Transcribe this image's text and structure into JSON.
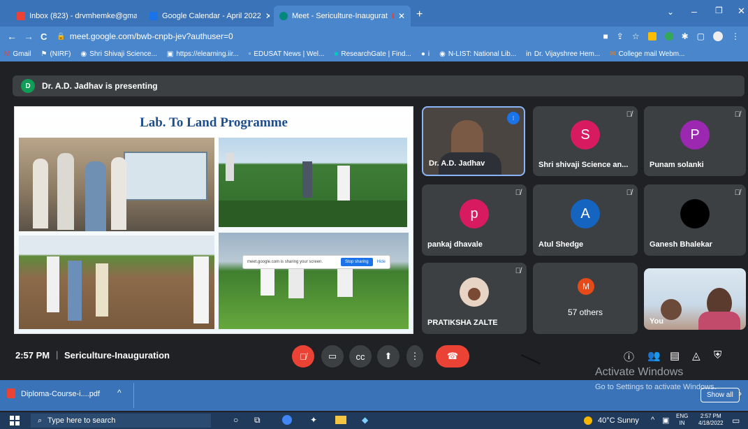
{
  "browser": {
    "tabs": [
      {
        "title": "Inbox (823) - drvmhemke@gmai",
        "icon": "gmail-icon",
        "color": "#ea4335"
      },
      {
        "title": "Google Calendar - April 2022",
        "icon": "calendar-icon",
        "color": "#1a73e8"
      },
      {
        "title": "Meet - Sericulture-Inaugurat",
        "icon": "meet-icon",
        "color": "#00897b"
      }
    ],
    "new_tab": "+",
    "url": "meet.google.com/bwb-cnpb-jev?authuser=0",
    "bookmarks": [
      "Gmail",
      "(NIRF)",
      "Shri Shivaji Science...",
      "https://elearning.iir...",
      "EDUSAT News | Wel...",
      "ResearchGate | Find...",
      "i",
      "N-LIST: National Lib...",
      "Dr. Vijayshree Hem...",
      "College mail Webm..."
    ]
  },
  "meet": {
    "presenter_initial": "D",
    "presenting_text": "Dr. A.D. Jadhav is presenting",
    "slide": {
      "title": "Lab. To Land Programme",
      "share_bar_text": "meet.google.com is sharing your screen.",
      "stop_sharing": "Stop sharing",
      "hide": "Hide"
    },
    "participants": [
      {
        "name": "Dr. A.D. Jadhav",
        "initial": "",
        "color": ""
      },
      {
        "name": "Shri shivaji Science an...",
        "initial": "S",
        "color": "#d81b60"
      },
      {
        "name": "Punam solanki",
        "initial": "P",
        "color": "#9c27b0"
      },
      {
        "name": "pankaj dhavale",
        "initial": "p",
        "color": "#d81b60"
      },
      {
        "name": "Atul Shedge",
        "initial": "A",
        "color": "#1565c0"
      },
      {
        "name": "Ganesh Bhalekar",
        "initial": "",
        "color": "#000000"
      },
      {
        "name": "PRATIKSHA ZALTE",
        "initial": "",
        "color": ""
      },
      {
        "name": "57 others",
        "initial": "M",
        "color": "#e64a19"
      },
      {
        "name": "You",
        "initial": "",
        "color": ""
      }
    ],
    "time": "2:57 PM",
    "separator": "|",
    "meeting_name": "Sericulture-Inauguration"
  },
  "watermark": {
    "line1": "Activate Windows",
    "line2": "Go to Settings to activate Windows."
  },
  "downloads": {
    "file": "Diploma-Course-i....pdf",
    "show_all": "Show all"
  },
  "taskbar": {
    "search_placeholder": "Type here to search",
    "weather": "40°C Sunny",
    "lang1": "ENG",
    "lang2": "IN",
    "time": "2:57 PM",
    "date": "4/18/2022"
  }
}
